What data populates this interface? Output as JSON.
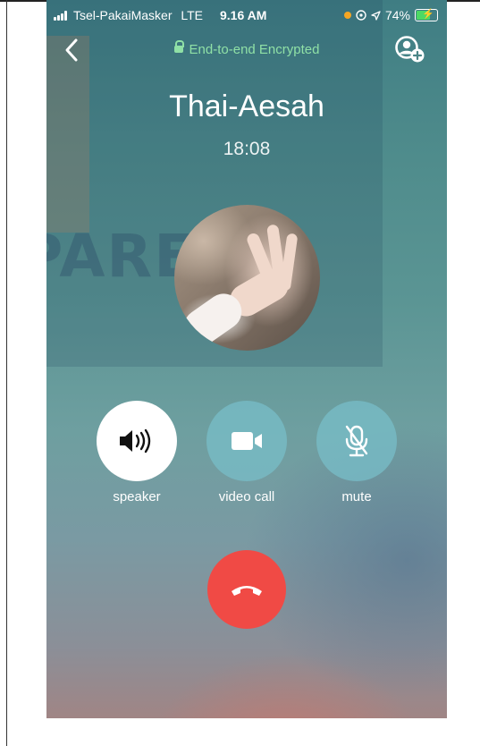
{
  "status_bar": {
    "carrier": "Tsel-PakaiMasker",
    "network": "LTE",
    "time": "9.16 AM",
    "battery": "74%",
    "battery_level": 0.74,
    "privacy_dot_color": "#f5a623",
    "battery_fill_color": "#4cd964"
  },
  "header": {
    "back_icon": "chevron-left-icon",
    "encryption_label": "End-to-end Encrypted",
    "encryption_color": "#8fe0a6",
    "add_participant_icon": "add-user-icon"
  },
  "call": {
    "contact_name": "Thai-Aesah",
    "duration": "18:08"
  },
  "watermark": {
    "text": "PARE"
  },
  "actions": [
    {
      "label": "speaker",
      "icon": "speaker-icon",
      "active": true
    },
    {
      "label": "video call",
      "icon": "video-camera-icon",
      "active": false
    },
    {
      "label": "mute",
      "icon": "microphone-muted-icon",
      "active": false
    }
  ],
  "end_call": {
    "icon": "phone-hangup-icon",
    "color": "#f04a45"
  }
}
